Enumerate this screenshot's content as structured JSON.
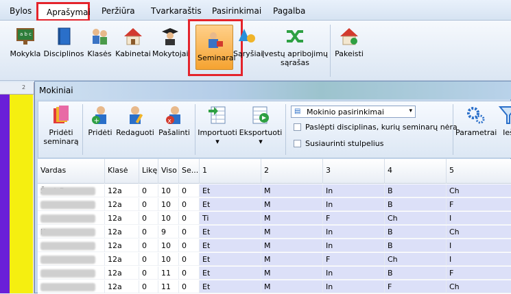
{
  "menu": {
    "items": [
      "Bylos",
      "Aprašymai",
      "Peržiūra",
      "Tvarkaraštis",
      "Pasirinkimai",
      "Pagalba"
    ]
  },
  "ribbon": {
    "buttons": [
      "Mokykla",
      "Disciplinos",
      "Klasės",
      "Kabinetai",
      "Mokytojai",
      "Seminarai",
      "Sąryšiai",
      "Įvestų apribojimų",
      "sąrašas",
      "Pakeisti"
    ]
  },
  "left_grid": {
    "header": "2"
  },
  "window": {
    "title": "Mokiniai",
    "toolbar": {
      "prideti_seminara_1": "Pridėti",
      "prideti_seminara_2": "seminarą",
      "prideti": "Pridėti",
      "redaguoti": "Redaguoti",
      "pasalinti": "Pašalinti",
      "importuoti": "Importuoti",
      "eksportuoti": "Eksportuoti",
      "dropdown_value": "Mokinio pasirinkimai",
      "check1": "Paslėpti disciplinas, kurių seminarų nėra",
      "check2": "Susiaurinti stulpelius",
      "parametrai": "Parametrai",
      "ieskoti": "Ieš"
    },
    "table": {
      "headers": [
        "Vardas",
        "Klasė",
        "Likę",
        "Viso",
        "Se...",
        "1",
        "2",
        "3",
        "4",
        "5"
      ],
      "rows": [
        {
          "name": "Š...ė B",
          "klase": "12a",
          "like": "0",
          "viso": "10",
          "se": "0",
          "c1": "Et",
          "c2": "M",
          "c3": "In",
          "c4": "B",
          "c5": "Ch"
        },
        {
          "name": "",
          "klase": "12a",
          "like": "0",
          "viso": "10",
          "se": "0",
          "c1": "Et",
          "c2": "M",
          "c3": "In",
          "c4": "B",
          "c5": "F"
        },
        {
          "name": "",
          "klase": "12a",
          "like": "0",
          "viso": "10",
          "se": "0",
          "c1": "Ti",
          "c2": "M",
          "c3": "F",
          "c4": "Ch",
          "c5": "I"
        },
        {
          "name": "Ke",
          "klase": "12a",
          "like": "0",
          "viso": "9",
          "se": "0",
          "c1": "Et",
          "c2": "M",
          "c3": "In",
          "c4": "B",
          "c5": "Ch"
        },
        {
          "name": "",
          "klase": "12a",
          "like": "0",
          "viso": "10",
          "se": "0",
          "c1": "Et",
          "c2": "M",
          "c3": "In",
          "c4": "B",
          "c5": "I"
        },
        {
          "name": "",
          "klase": "12a",
          "like": "0",
          "viso": "10",
          "se": "0",
          "c1": "Et",
          "c2": "M",
          "c3": "F",
          "c4": "Ch",
          "c5": "I"
        },
        {
          "name": "",
          "klase": "12a",
          "like": "0",
          "viso": "11",
          "se": "0",
          "c1": "Et",
          "c2": "M",
          "c3": "In",
          "c4": "B",
          "c5": "F"
        },
        {
          "name": "",
          "klase": "12a",
          "like": "0",
          "viso": "11",
          "se": "0",
          "c1": "Et",
          "c2": "M",
          "c3": "In",
          "c4": "F",
          "c5": "Ch"
        }
      ]
    }
  },
  "colors": {
    "highlight": "#e4232b",
    "active_button": "#f5a331",
    "grid_cell": "#dce0f8"
  }
}
